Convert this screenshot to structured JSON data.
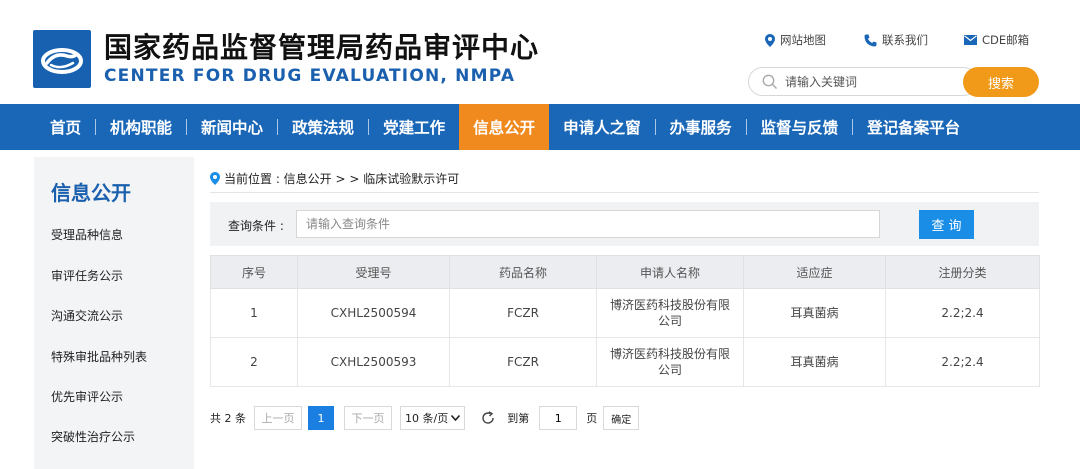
{
  "header": {
    "title_cn": "国家药品监督管理局药品审评中心",
    "title_en": "CENTER FOR DRUG EVALUATION, NMPA",
    "links": [
      {
        "label": "网站地图",
        "icon": "location-pin-icon"
      },
      {
        "label": "联系我们",
        "icon": "phone-icon"
      },
      {
        "label": "CDE邮箱",
        "icon": "mail-icon"
      }
    ],
    "search_placeholder": "请输入关键词",
    "search_button": "搜索"
  },
  "nav": {
    "items": [
      "首页",
      "机构职能",
      "新闻中心",
      "政策法规",
      "党建工作",
      "信息公开",
      "申请人之窗",
      "办事服务",
      "监督与反馈",
      "登记备案平台"
    ],
    "active": "信息公开"
  },
  "sidebar": {
    "title": "信息公开",
    "items": [
      "受理品种信息",
      "审评任务公示",
      "沟通交流公示",
      "特殊审批品种列表",
      "优先审评公示",
      "突破性治疗公示"
    ]
  },
  "breadcrumb": {
    "text": "当前位置 : 信息公开 > > 临床试验默示许可"
  },
  "query": {
    "label": "查询条件 :",
    "placeholder": "请输入查询条件",
    "button": "查 询"
  },
  "table": {
    "headers": [
      "序号",
      "受理号",
      "药品名称",
      "申请人名称",
      "适应症",
      "注册分类"
    ],
    "rows": [
      [
        "1",
        "CXHL2500594",
        "FCZR",
        "博济医药科技股份有限公司",
        "耳真菌病",
        "2.2;2.4"
      ],
      [
        "2",
        "CXHL2500593",
        "FCZR",
        "博济医药科技股份有限公司",
        "耳真菌病",
        "2.2;2.4"
      ]
    ]
  },
  "pagination": {
    "total": "共 2 条",
    "prev": "上一页",
    "current": "1",
    "next": "下一页",
    "page_size": "10 条/页",
    "goto_label": "到第",
    "goto_value": "1",
    "page_unit": "页",
    "confirm": "确定"
  },
  "colors": {
    "brand_blue": "#1a67b8",
    "active_orange": "#f08a1f",
    "search_orange": "#f19a1a",
    "query_blue": "#1a8ee6"
  }
}
